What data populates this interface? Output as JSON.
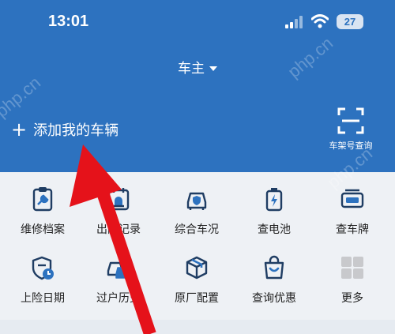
{
  "status_bar": {
    "time": "13:01",
    "battery": "27"
  },
  "header": {
    "title": "车主",
    "add_car": "添加我的车辆",
    "scan_label": "车架号查询"
  },
  "grid": {
    "row1": [
      {
        "label": "维修档案",
        "icon": "wrench-clipboard-icon"
      },
      {
        "label": "出险记录",
        "icon": "siren-calendar-icon"
      },
      {
        "label": "综合车况",
        "icon": "car-shield-icon"
      },
      {
        "label": "查电池",
        "icon": "battery-icon"
      },
      {
        "label": "查车牌",
        "icon": "license-plate-icon"
      }
    ],
    "row2": [
      {
        "label": "上险日期",
        "icon": "shield-clock-icon"
      },
      {
        "label": "过户历史",
        "icon": "car-transfer-icon"
      },
      {
        "label": "原厂配置",
        "icon": "box-icon"
      },
      {
        "label": "查询优惠",
        "icon": "shopping-bag-icon"
      },
      {
        "label": "更多",
        "icon": "grid-icon"
      }
    ]
  },
  "watermark": "php.cn",
  "colors": {
    "header": "#2d72bf",
    "icon_stroke": "#1f3d63",
    "icon_accent": "#2d72bf",
    "arrow": "#e5121a"
  }
}
